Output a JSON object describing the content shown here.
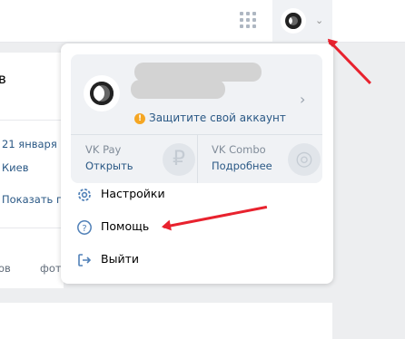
{
  "header": {
    "apps_icon": "grid-icon",
    "avatar_icon": "avatar",
    "chevron": "⌄"
  },
  "profile_card": {
    "warning_text": "Защитите свой аккаунт",
    "warning_icon": "!",
    "chevron": "›"
  },
  "services": [
    {
      "title": "VK Pay",
      "link": "Открыть",
      "watermark": "₽"
    },
    {
      "title": "VK Combo",
      "link": "Подробнее",
      "watermark": "◎"
    }
  ],
  "menu_items": [
    {
      "label": "Настройки",
      "icon": "gear-icon"
    },
    {
      "label": "Помощь",
      "icon": "help-icon"
    },
    {
      "label": "Выйти",
      "icon": "logout-icon"
    }
  ],
  "background_page": {
    "name_fragment": "в",
    "birthday": "21 января",
    "city": "Киев",
    "show_more": "Показать п",
    "tab_1": "ов",
    "tab_2": "фот"
  },
  "annotation_colors": {
    "arrow": "#e8222e"
  }
}
